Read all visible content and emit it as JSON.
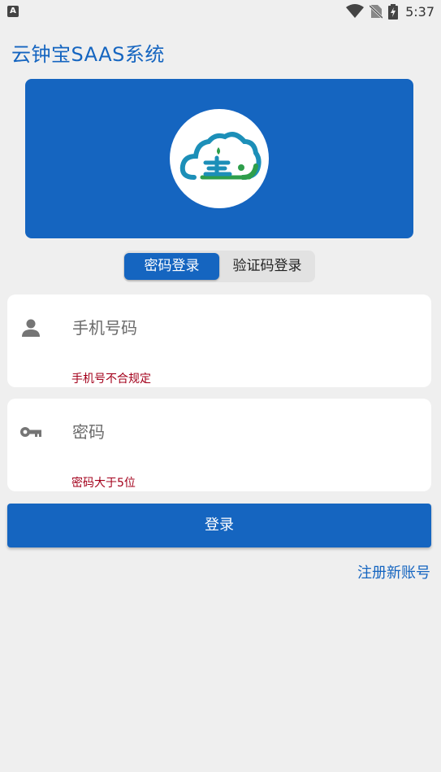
{
  "statusbar": {
    "app_badge": "A",
    "time": "5:37"
  },
  "app": {
    "title": "云钟宝SAAS系统"
  },
  "tabs": [
    {
      "label": "密码登录",
      "active": true
    },
    {
      "label": "验证码登录",
      "active": false
    }
  ],
  "phone": {
    "placeholder": "手机号码",
    "value": "",
    "error": "手机号不合规定"
  },
  "password": {
    "placeholder": "密码",
    "value": "",
    "error": "密码大于5位"
  },
  "actions": {
    "login_label": "登录",
    "register_label": "注册新账号"
  },
  "colors": {
    "primary": "#1565c0",
    "error": "#a3001b",
    "background": "#efefef"
  },
  "icons": [
    "app-badge-icon",
    "wifi-icon",
    "no-sim-icon",
    "battery-charging-icon",
    "person-icon",
    "key-icon",
    "cloud-logo-icon"
  ]
}
